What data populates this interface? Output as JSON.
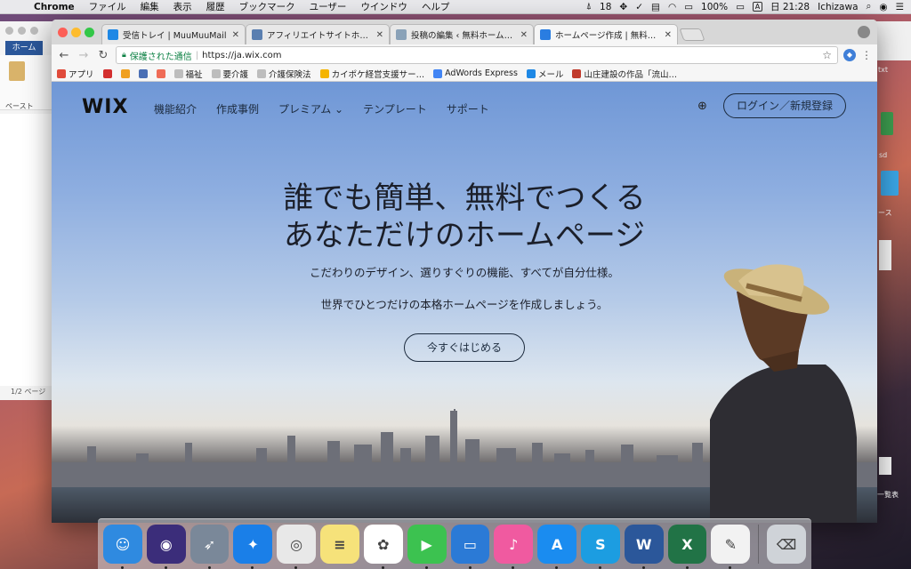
{
  "menubar": {
    "app_name": "Chrome",
    "items": [
      "ファイル",
      "編集",
      "表示",
      "履歴",
      "ブックマーク",
      "ユーザー",
      "ウインドウ",
      "ヘルプ"
    ],
    "adobe_count": "18",
    "battery": "100%",
    "input_mode": "A",
    "clock": "日 21:28",
    "user": "Ichizawa"
  },
  "background_word": {
    "tab_home": "ホーム",
    "paste_label": "ペースト",
    "status": "1/2 ページ"
  },
  "background_right": {
    "txt1": "txt",
    "txt2": "sd",
    "txt3": "ース",
    "txt4": "一覧表"
  },
  "chrome": {
    "tabs": [
      {
        "title": "受信トレイ | MuuMuuMail",
        "color": "#1e88e5"
      },
      {
        "title": "アフィリエイトサイトホーム",
        "color": "#5a7fb0"
      },
      {
        "title": "投稿の編集 ‹ 無料ホームページ作成",
        "color": "#8aa2b8"
      },
      {
        "title": "ホームページ作成 | 無料ホームペー",
        "color": "#2a7de1"
      }
    ],
    "omnibox": {
      "secure_label": "保護された通信",
      "url": "https://ja.wix.com"
    },
    "bookmarks": [
      {
        "label": "アプリ",
        "color": "#e04b3b"
      },
      {
        "label": "",
        "color": "#d32f2f"
      },
      {
        "label": "",
        "color": "#f0a020"
      },
      {
        "label": "",
        "color": "#4a6fb5"
      },
      {
        "label": "",
        "color": "#ef6c57"
      },
      {
        "label": "福祉",
        "color": "#9e9e9e"
      },
      {
        "label": "要介護",
        "color": "#9e9e9e"
      },
      {
        "label": "介護保険法",
        "color": "#9e9e9e"
      },
      {
        "label": "カイポケ経営支援サー…",
        "color": "#f5b400"
      },
      {
        "label": "AdWords Express",
        "color": "#4285f4"
      },
      {
        "label": "メール",
        "color": "#1e88e5"
      },
      {
        "label": "山庄建設の作品「流山…",
        "color": "#c0392b"
      }
    ]
  },
  "wix": {
    "logo": "WIX",
    "nav": [
      "機能紹介",
      "作成事例",
      "プレミアム ⌄",
      "テンプレート",
      "サポート"
    ],
    "login_label": "ログイン／新規登録",
    "headline_line1": "誰でも簡単、無料でつくる",
    "headline_line2": "あなただけのホームページ",
    "sub1": "こだわりのデザイン、選りすぐりの機能、すべてが自分仕様。",
    "sub2": "世界でひとつだけの本格ホームページを作成しましょう。",
    "cta": "今すぐはじめる"
  },
  "dock": [
    {
      "name": "finder",
      "color": "#2f8ae0",
      "glyph": "☺"
    },
    {
      "name": "siri",
      "color": "#3b2d7a",
      "glyph": "◉"
    },
    {
      "name": "launchpad",
      "color": "#7a8899",
      "glyph": "➶"
    },
    {
      "name": "safari",
      "color": "#1a7fe8",
      "glyph": "✦"
    },
    {
      "name": "chrome",
      "color": "#e8e8e8",
      "glyph": "◎"
    },
    {
      "name": "notes",
      "color": "#f6e27a",
      "glyph": "≡"
    },
    {
      "name": "photos",
      "color": "#ffffff",
      "glyph": "✿"
    },
    {
      "name": "facetime",
      "color": "#3cc250",
      "glyph": "▶"
    },
    {
      "name": "keynote",
      "color": "#2b7ad6",
      "glyph": "▭"
    },
    {
      "name": "itunes",
      "color": "#f05aa0",
      "glyph": "♪"
    },
    {
      "name": "appstore",
      "color": "#1a8cf0",
      "glyph": "A"
    },
    {
      "name": "skype",
      "color": "#1c9de1",
      "glyph": "S"
    },
    {
      "name": "word",
      "color": "#2b579a",
      "glyph": "W"
    },
    {
      "name": "excel",
      "color": "#217346",
      "glyph": "X"
    },
    {
      "name": "textedit",
      "color": "#f2f2f2",
      "glyph": "✎"
    },
    {
      "name": "trash",
      "color": "#cfd3d8",
      "glyph": "⌫"
    }
  ]
}
